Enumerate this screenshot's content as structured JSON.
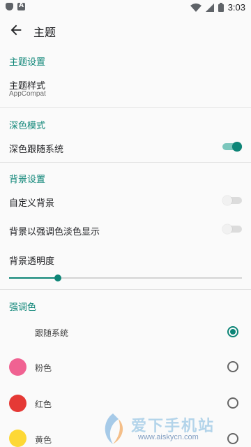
{
  "status_bar": {
    "time": "3:03"
  },
  "top_bar": {
    "title": "主题"
  },
  "sections": {
    "theme": {
      "header": "主题设置",
      "style_title": "主题样式",
      "style_summary": "AppCompat"
    },
    "dark": {
      "header": "深色模式",
      "follow_system_title": "深色跟随系统",
      "follow_system_on": true
    },
    "background": {
      "header": "背景设置",
      "custom_title": "自定义背景",
      "custom_on": false,
      "tint_title": "背景以强调色淡色显示",
      "tint_on": false,
      "opacity_title": "背景透明度",
      "opacity_fraction": 0.21
    },
    "accent": {
      "header": "强调色",
      "options": [
        {
          "label": "跟随系统",
          "color": null,
          "selected": true
        },
        {
          "label": "粉色",
          "color": "#f06292",
          "selected": false
        },
        {
          "label": "红色",
          "color": "#e53935",
          "selected": false
        },
        {
          "label": "黄色",
          "color": "#fdd835",
          "selected": false
        }
      ]
    }
  },
  "watermark": {
    "text": "爱下手机站",
    "url": "www.aiskycn.com"
  },
  "colors": {
    "accent": "#0d8577"
  }
}
